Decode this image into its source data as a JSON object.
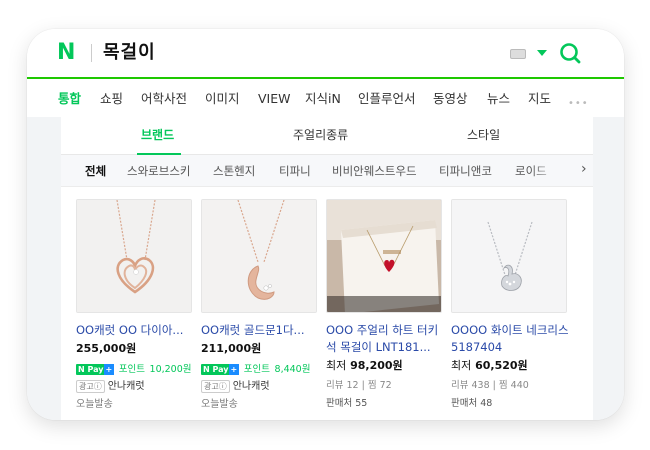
{
  "search": {
    "logo": "N",
    "query": "목걸이"
  },
  "nav": {
    "items": [
      "통합",
      "쇼핑",
      "어학사전",
      "이미지",
      "VIEW",
      "지식iN",
      "인플루언서",
      "동영상",
      "뉴스",
      "지도"
    ],
    "active": "통합",
    "more": "•••"
  },
  "subtabs": {
    "items": [
      "브랜드",
      "주얼리종류",
      "스타일"
    ],
    "active": "브랜드"
  },
  "chips": {
    "items": [
      "전체",
      "스와로브스키",
      "스톤헨지",
      "티파니",
      "비비안웨스트우드",
      "티파니앤코",
      "로이드"
    ],
    "active": "전체",
    "arrow": "›"
  },
  "products": [
    {
      "title": "OO캐럿 OO 다이아...",
      "price": "255,000원",
      "npay": "N Pay",
      "npay_plus": "+",
      "point_label": "포인트",
      "point": "10,200원",
      "ad_tag": "광고ⓘ",
      "seller": "안나캐럿",
      "shipping": "오늘발송"
    },
    {
      "title": "OO캐럿 골드문1다...",
      "price": "211,000원",
      "npay": "N Pay",
      "npay_plus": "+",
      "point_label": "포인트",
      "point": "8,440원",
      "ad_tag": "광고ⓘ",
      "seller": "안나캐럿",
      "shipping": "오늘발송"
    },
    {
      "title": "OOO 주얼리 하트 터키석 목걸이 LNT181...",
      "price_label": "최저",
      "price": "98,200원",
      "reviews": "리뷰 12",
      "saves": "찜 72",
      "sellers": "판매처 55"
    },
    {
      "title": "OOOO 화이트 네크리스 5187404",
      "price_label": "최저",
      "price": "60,520원",
      "reviews": "리뷰 438",
      "saves": "찜 440",
      "sellers": "판매처 48"
    }
  ],
  "colors": {
    "brand_green": "#03c75a",
    "link_blue": "#2a4aa8",
    "pay_blue": "#1a8cff"
  }
}
